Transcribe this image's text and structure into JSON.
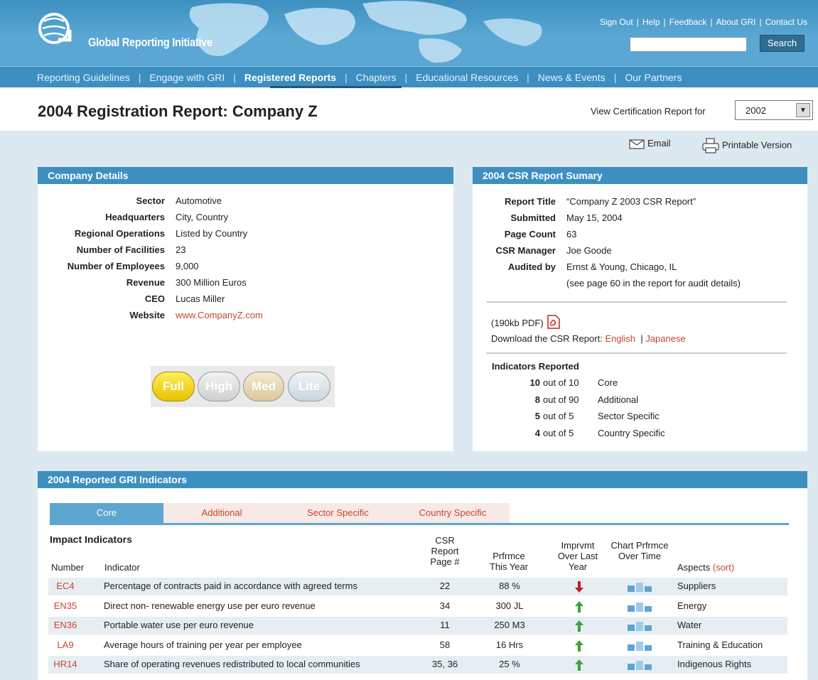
{
  "header": {
    "logo_text": "Global Reporting Initiative",
    "top_links": [
      "Sign Out",
      "Help",
      "Feedback",
      "About GRI",
      "Contact Us"
    ],
    "search_placeholder": "",
    "search_button": "Search"
  },
  "nav": {
    "items": [
      "Reporting Guidelines",
      "Engage with GRI",
      "Registered Reports",
      "Chapters",
      "Educational Resources",
      "News & Events",
      "Our Partners"
    ],
    "active": "Registered Reports"
  },
  "page": {
    "title": "2004 Registration Report: Company Z",
    "view_cert_label": "View Certification Report for",
    "year_selected": "2002"
  },
  "tools": {
    "email": "Email",
    "printable": "Printable Version"
  },
  "company_details": {
    "heading": "Company Details",
    "rows": [
      {
        "label": "Sector",
        "value": "Automotive"
      },
      {
        "label": "Headquarters",
        "value": "City, Country"
      },
      {
        "label": "Regional Operations",
        "value": "Listed by Country"
      },
      {
        "label": "Number of Facilities",
        "value": "23"
      },
      {
        "label": "Number of Employees",
        "value": "9,000"
      },
      {
        "label": "Revenue",
        "value": "300 Million Euros"
      },
      {
        "label": "CEO",
        "value": "Lucas Miller"
      },
      {
        "label": "Website",
        "value": "www.CompanyZ.com"
      }
    ],
    "ratings": [
      "Full",
      "High",
      "Med",
      "Lite"
    ],
    "rating_selected": "Full"
  },
  "csr_summary": {
    "heading": "2004 CSR Report Sumary",
    "rows": [
      {
        "label": "Report Title",
        "value": "“Company Z 2003 CSR Report”"
      },
      {
        "label": "Submitted",
        "value": "May 15, 2004"
      },
      {
        "label": "Page Count",
        "value": "63"
      },
      {
        "label": "CSR Manager",
        "value": "Joe Goode"
      },
      {
        "label": "Audited by",
        "value": "Ernst & Young, Chicago, IL"
      }
    ],
    "audit_note": "(see page 60 in the report for audit details)",
    "pdf_size": "(190kb PDF)",
    "download_label": "Download the CSR Report:",
    "download_english": "English",
    "download_japanese": "Japanese",
    "indicators_heading": "Indicators Reported",
    "indicators": [
      {
        "count": "10",
        "of": "out of 10",
        "type": "Core"
      },
      {
        "count": "8",
        "of": "out of 90",
        "type": "Additional"
      },
      {
        "count": "5",
        "of": "out of 5",
        "type": "Sector Specific"
      },
      {
        "count": "4",
        "of": "out of 5",
        "type": "Country Specific"
      }
    ]
  },
  "gri_indicators": {
    "heading": "2004 Reported GRI Indicators",
    "tabs": [
      "Core",
      "Additional",
      "Sector Specific",
      "Country Specific"
    ],
    "active_tab": "Core",
    "section_title": "Impact Indicators",
    "columns": {
      "number": "Number",
      "indicator": "Indicator",
      "csr_page": "CSR Report Page #",
      "performance": "Prfrmce This Year",
      "improvement": "Imprvmt Over Last Year",
      "chart": "Chart Prfrmce Over Time",
      "aspects": "Aspects",
      "sort": "(sort)"
    },
    "rows": [
      {
        "number": "EC4",
        "indicator": "Percentage of contracts paid in accordance with agreed terms",
        "page": "22",
        "performance": "88 %",
        "trend": "down",
        "aspect": "Suppliers"
      },
      {
        "number": "EN35",
        "indicator": "Direct non- renewable energy use per euro revenue",
        "page": "34",
        "performance": "300 JL",
        "trend": "up",
        "aspect": "Energy"
      },
      {
        "number": "EN36",
        "indicator": "Portable water use per euro revenue",
        "page": "11",
        "performance": "250 M3",
        "trend": "up",
        "aspect": "Water"
      },
      {
        "number": "LA9",
        "indicator": "Average hours of training per year per employee",
        "page": "58",
        "performance": "16 Hrs",
        "trend": "up",
        "aspect": "Training & Education"
      },
      {
        "number": "HR14",
        "indicator": "Share of operating revenues redistributed to local communities",
        "page": "35, 36",
        "performance": "25 %",
        "trend": "up",
        "aspect": "Indigenous Rights"
      }
    ]
  }
}
